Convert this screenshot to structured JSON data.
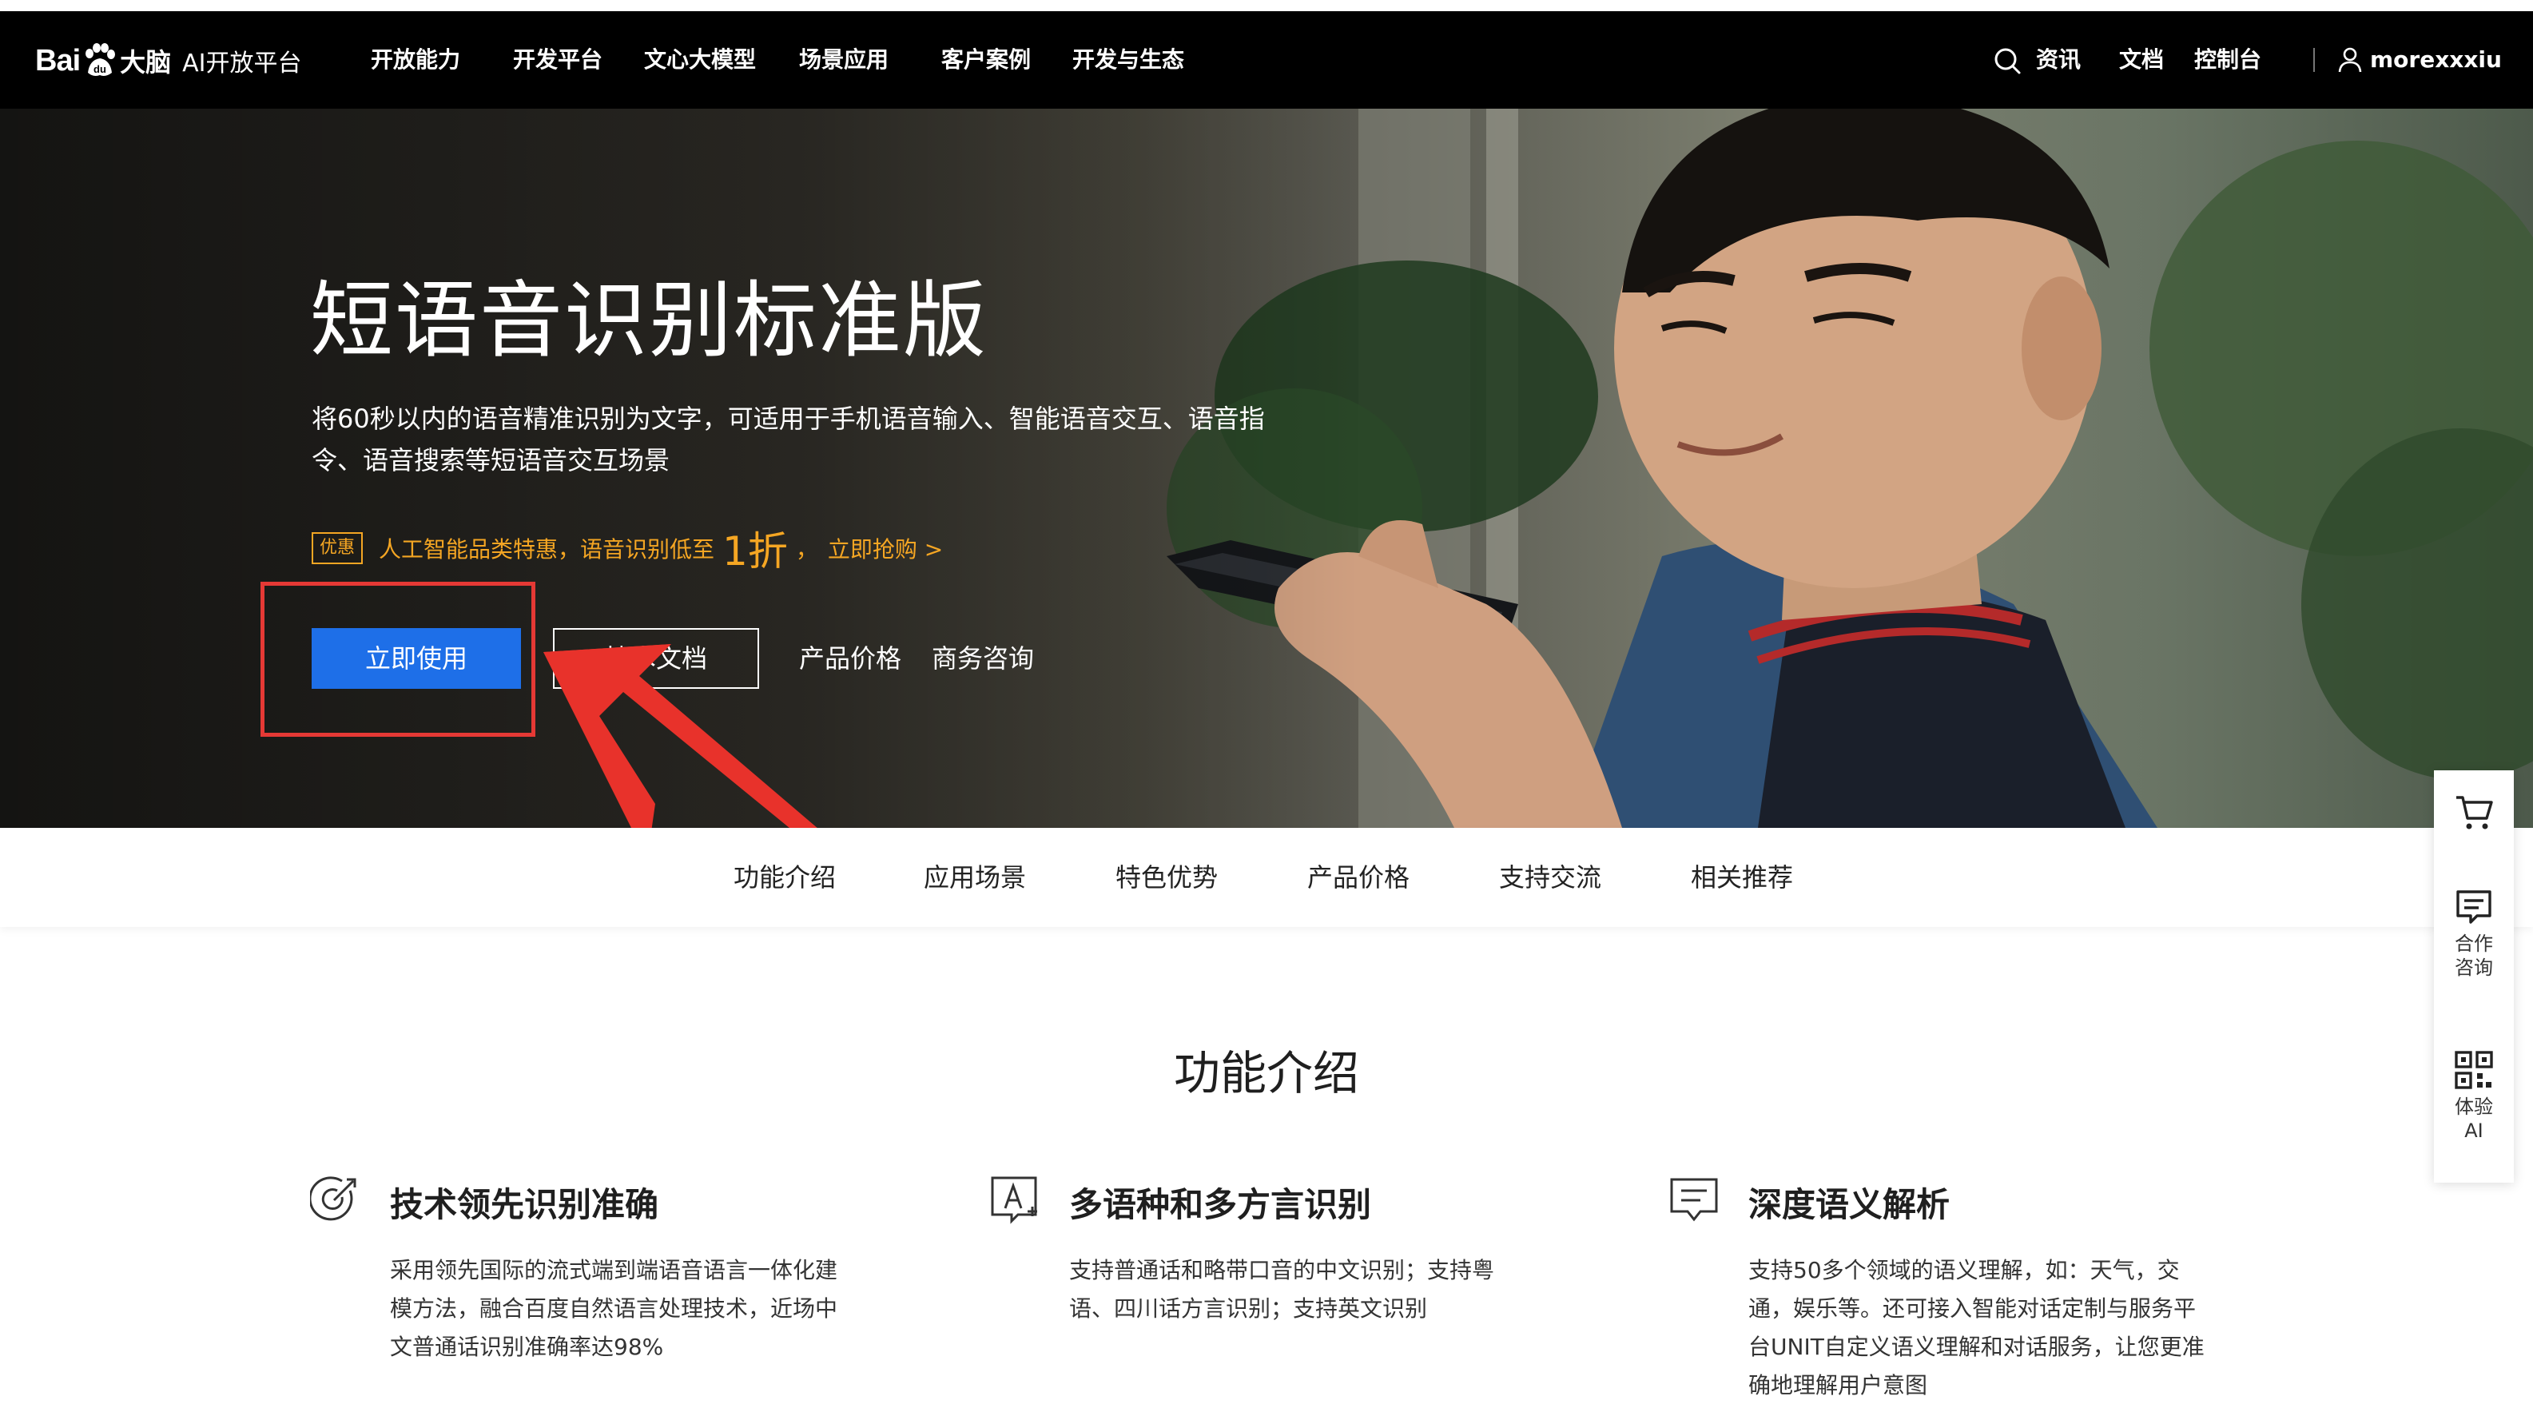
{
  "nav": {
    "logo": {
      "bai": "Bai",
      "brain": "大脑",
      "platform": "AI开放平台"
    },
    "menu": [
      "开放能力",
      "开发平台",
      "文心大模型",
      "场景应用",
      "客户案例",
      "开发与生态"
    ],
    "right": {
      "news": "资讯",
      "docs": "文档",
      "console": "控制台",
      "username": "morexxxiu"
    }
  },
  "hero": {
    "title": "短语音识别标准版",
    "description": "将60秒以内的语音精准识别为文字，可适用于手机语音输入、智能语音交互、语音指令、语音搜索等短语音交互场景",
    "promo": {
      "tag": "优惠",
      "text": "人工智能品类特惠，语音识别低至",
      "highlight": "1折",
      "sep": "，",
      "link": "立即抢购 >"
    },
    "primary_button": "立即使用",
    "outline_button": "技术文档",
    "link_price": "产品价格",
    "link_consult": "商务咨询"
  },
  "subtabs": [
    "功能介绍",
    "应用场景",
    "特色优势",
    "产品价格",
    "支持交流",
    "相关推荐"
  ],
  "section": {
    "title": "功能介绍",
    "features": [
      {
        "title": "技术领先识别准确",
        "body": "采用领先国际的流式端到端语音语言一体化建模方法，融合百度自然语言处理技术，近场中文普通话识别准确率达98%"
      },
      {
        "title": "多语种和多方言识别",
        "body": "支持普通话和略带口音的中文识别；支持粤语、四川话方言识别；支持英文识别"
      },
      {
        "title": "深度语义解析",
        "body": "支持50多个领域的语义理解，如：天气，交通，娱乐等。还可接入智能对话定制与服务平台UNIT自定义语义理解和对话服务，让您更准确地理解用户意图"
      }
    ]
  },
  "floatbar": {
    "consult": "合作咨询",
    "experience": "体验AI"
  },
  "colors": {
    "nav_bg": "#000000",
    "primary": "#1e6fe8",
    "promo": "#f5a623",
    "highlight_box": "#e53935"
  }
}
